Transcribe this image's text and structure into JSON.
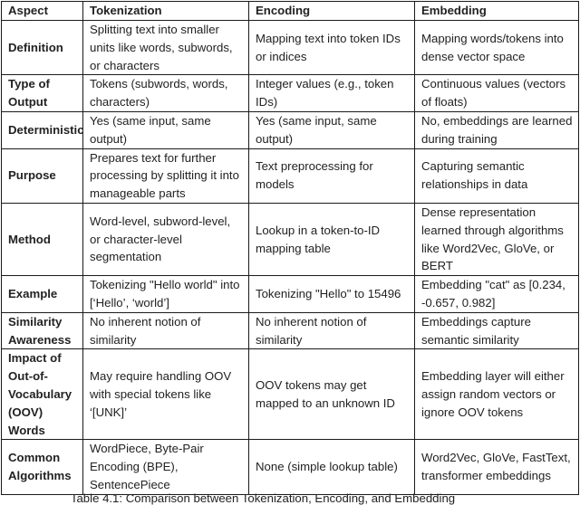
{
  "table": {
    "headers": [
      "Aspect",
      "Tokenization",
      "Encoding",
      "Embedding"
    ],
    "rows": [
      {
        "aspect": "Definition",
        "tokenization": "Splitting text into smaller units like words, subwords, or characters",
        "encoding": "Mapping text into token IDs or indices",
        "embedding": "Mapping words/tokens into dense vector space"
      },
      {
        "aspect": "Type of Output",
        "tokenization": "Tokens (subwords, words, characters)",
        "encoding": "Integer values (e.g., token IDs)",
        "embedding": "Continuous values (vectors of floats)"
      },
      {
        "aspect": "Deterministic?",
        "tokenization": "Yes (same input, same output)",
        "encoding": "Yes (same input, same output)",
        "embedding": "No, embeddings are learned during training"
      },
      {
        "aspect": "Purpose",
        "tokenization": "Prepares text for further processing by splitting it into manageable parts",
        "encoding": "Text preprocessing for models",
        "embedding": "Capturing semantic relationships in data"
      },
      {
        "aspect": "Method",
        "tokenization": "Word-level, subword-level, or character-level segmentation",
        "encoding": "Lookup in a token-to-ID mapping table",
        "embedding": "Dense representation learned through algorithms like Word2Vec, GloVe, or BERT"
      },
      {
        "aspect": "Example",
        "tokenization": "Tokenizing \"Hello world\" into [‘Hello’, ‘world’]",
        "encoding": "Tokenizing \"Hello\" to 15496",
        "embedding": "Embedding \"cat\" as [0.234, -0.657, 0.982]"
      },
      {
        "aspect": "Similarity Awareness",
        "tokenization": "No inherent notion of similarity",
        "encoding": "No inherent notion of similarity",
        "embedding": "Embeddings capture semantic similarity"
      },
      {
        "aspect": "Impact of Out-of-Vocabulary (OOV) Words",
        "tokenization": "May require handling OOV with special tokens like ‘[UNK]’",
        "encoding": "OOV tokens may get mapped to an unknown ID",
        "embedding": "Embedding layer will either assign random vectors or ignore OOV tokens"
      },
      {
        "aspect": "Common Algorithms",
        "tokenization": "WordPiece, Byte-Pair Encoding (BPE), SentencePiece",
        "encoding": "None (simple lookup table)",
        "embedding": "Word2Vec, GloVe, FastText, transformer embeddings"
      }
    ]
  },
  "caption": "Table 4.1: Comparison between Tokenization, Encoding, and Embedding"
}
